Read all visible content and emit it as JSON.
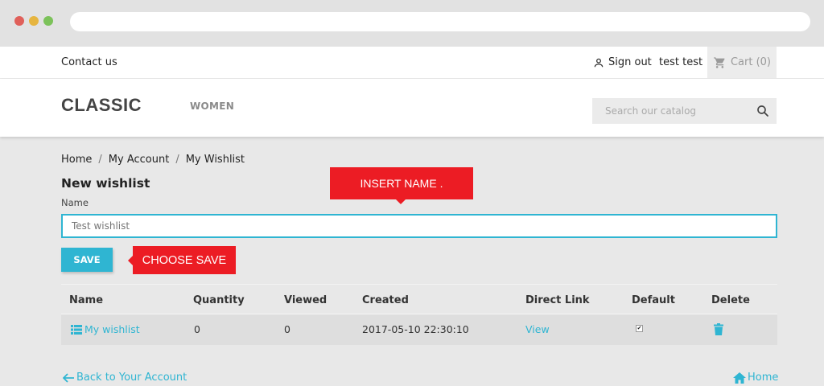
{
  "top_nav": {
    "contact": "Contact us",
    "sign_out": "Sign out",
    "username": "test test",
    "cart": "Cart (0)"
  },
  "header": {
    "logo": "CLASSIC",
    "nav_women": "WOMEN",
    "search_placeholder": "Search our catalog"
  },
  "breadcrumb": [
    "Home",
    "My Account",
    "My Wishlist"
  ],
  "form": {
    "title": "New wishlist",
    "name_label": "Name",
    "name_placeholder": "Test wishlist",
    "save_label": "SAVE"
  },
  "callouts": {
    "insert_name": "INSERT NAME .",
    "choose_save": "CHOOSE SAVE"
  },
  "table": {
    "headers": [
      "Name",
      "Quantity",
      "Viewed",
      "Created",
      "Direct Link",
      "Default",
      "Delete"
    ],
    "rows": [
      {
        "name": "My wishlist",
        "quantity": "0",
        "viewed": "0",
        "created": "2017-05-10 22:30:10",
        "link": "View",
        "default_checked": true
      }
    ]
  },
  "footer": {
    "back": "Back to Your Account",
    "home": "Home"
  },
  "colors": {
    "accent": "#2fb5d2",
    "callout": "#ec1c24"
  }
}
